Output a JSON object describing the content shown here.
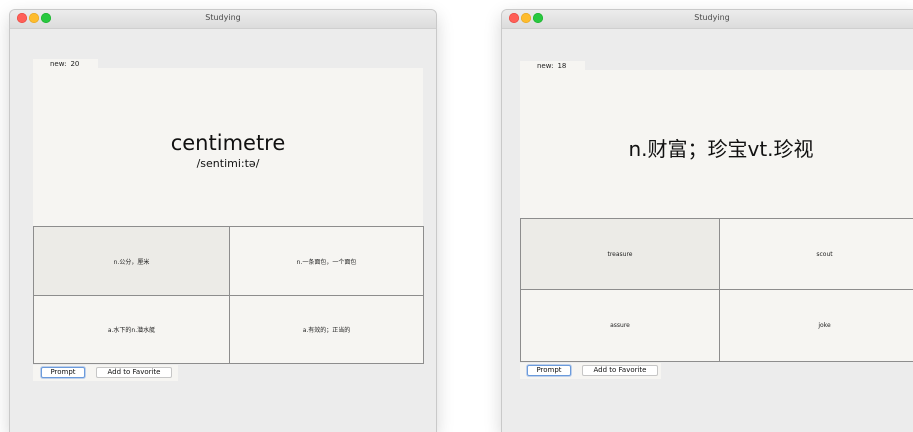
{
  "windows": [
    {
      "title": "Studying",
      "tab": {
        "label": "new:",
        "value": "20"
      },
      "word": "centimetre",
      "phonetic": "/sentimi:tə/",
      "options": [
        "n.公分，厘米",
        "n.一条面包，一个面包",
        "a.水下的n.潜水艇",
        "a.有效的；正当的"
      ],
      "buttons": {
        "prompt": "Prompt",
        "favorite": "Add to Favorite"
      }
    },
    {
      "title": "Studying",
      "tab": {
        "label": "new:",
        "value": "18"
      },
      "word": "n.财富；珍宝vt.珍视",
      "options": [
        "treasure",
        "scout",
        "assure",
        "joke"
      ],
      "buttons": {
        "prompt": "Prompt",
        "favorite": "Add to Favorite"
      }
    }
  ]
}
